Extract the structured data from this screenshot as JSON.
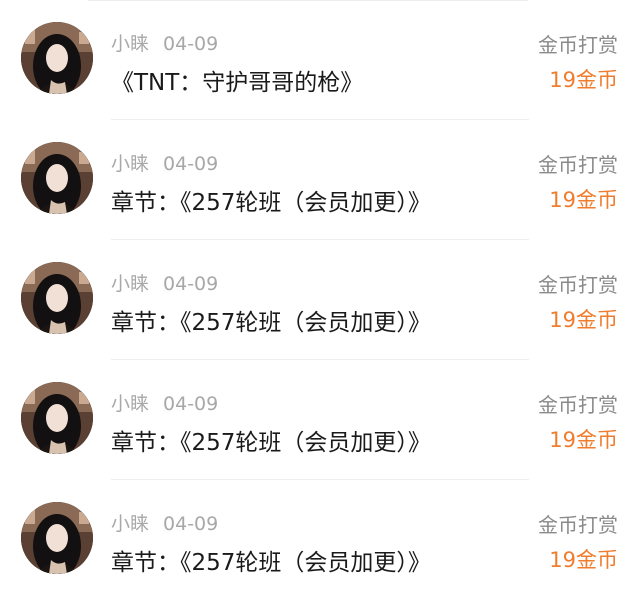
{
  "records": [
    {
      "user": "小睐",
      "date": "04-09",
      "title": "《TNT：守护哥哥的枪》",
      "label": "金币打赏",
      "amount": "19金币"
    },
    {
      "user": "小睐",
      "date": "04-09",
      "title": "章节：《257轮班（会员加更）》",
      "label": "金币打赏",
      "amount": "19金币"
    },
    {
      "user": "小睐",
      "date": "04-09",
      "title": "章节：《257轮班（会员加更）》",
      "label": "金币打赏",
      "amount": "19金币"
    },
    {
      "user": "小睐",
      "date": "04-09",
      "title": "章节：《257轮班（会员加更）》",
      "label": "金币打赏",
      "amount": "19金币"
    },
    {
      "user": "小睐",
      "date": "04-09",
      "title": "章节：《257轮班（会员加更）》",
      "label": "金币打赏",
      "amount": "19金币"
    }
  ],
  "colors": {
    "amount": "#ef7d2d",
    "meta": "#a8a8a8",
    "title": "#1a1a1a",
    "label": "#8a8a8a"
  }
}
